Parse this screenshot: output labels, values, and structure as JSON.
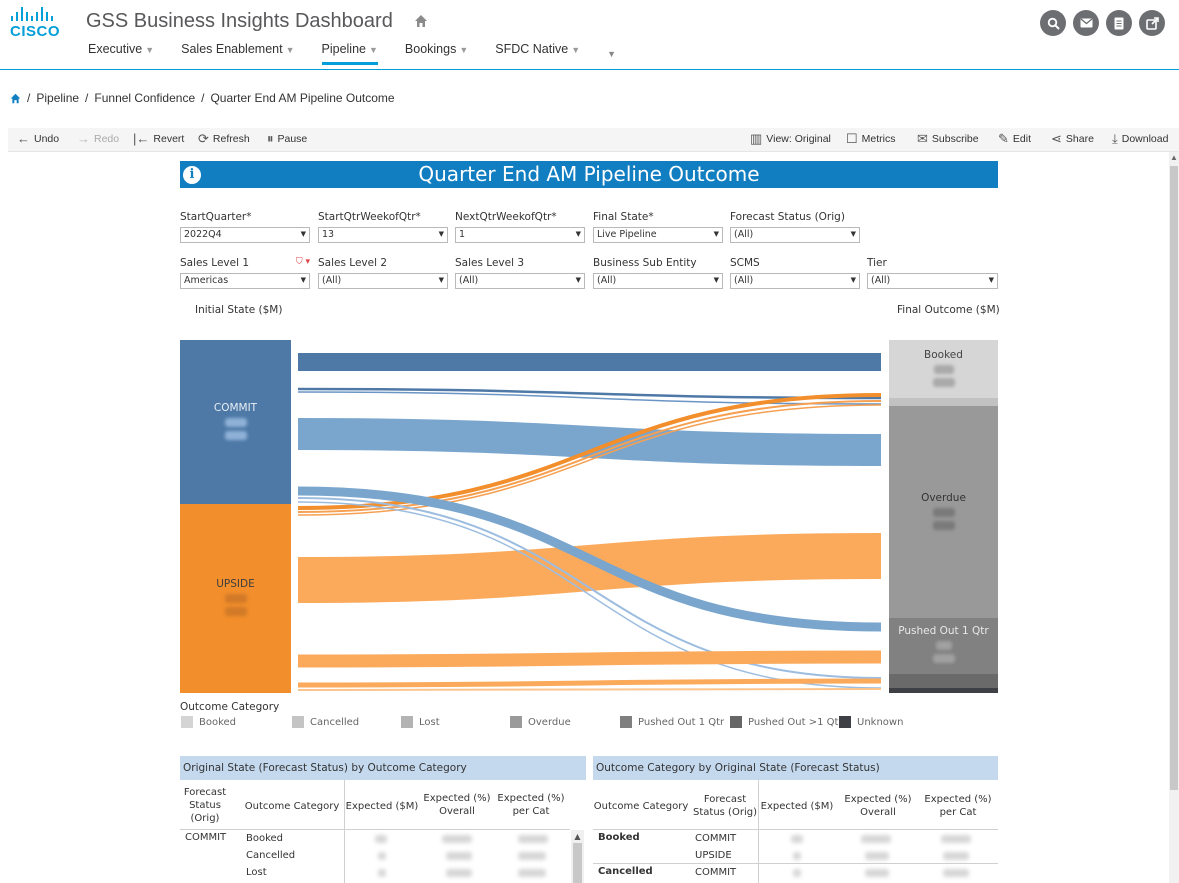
{
  "header": {
    "logo_text": "CISCO",
    "app_title": "GSS Business Insights Dashboard",
    "home_icon": "home-icon",
    "action_icons": [
      "search-icon",
      "mail-icon",
      "document-icon",
      "external-link-icon"
    ]
  },
  "nav": {
    "items": [
      {
        "label": "Executive",
        "active": false
      },
      {
        "label": "Sales Enablement",
        "active": false
      },
      {
        "label": "Pipeline",
        "active": true
      },
      {
        "label": "Bookings",
        "active": false
      },
      {
        "label": "SFDC Native",
        "active": false
      }
    ]
  },
  "breadcrumb": [
    "Pipeline",
    "Funnel Confidence",
    "Quarter End AM Pipeline Outcome"
  ],
  "toolbar": {
    "undo": "Undo",
    "redo": "Redo",
    "revert": "Revert",
    "refresh": "Refresh",
    "pause": "Pause",
    "view": "View: Original",
    "metrics": "Metrics",
    "subscribe": "Subscribe",
    "edit": "Edit",
    "share": "Share",
    "download": "Download"
  },
  "dashboard": {
    "title": "Quarter End AM Pipeline Outcome",
    "info_icon": "i",
    "filters_row1": [
      {
        "label": "StartQuarter*",
        "value": "2022Q4"
      },
      {
        "label": "StartQtrWeekofQtr*",
        "value": "13"
      },
      {
        "label": "NextQtrWeekofQtr*",
        "value": "1"
      },
      {
        "label": "Final State*",
        "value": "Live Pipeline"
      },
      {
        "label": "Forecast Status (Orig)",
        "value": "(All)"
      }
    ],
    "filters_row2": [
      {
        "label": "Sales Level 1",
        "value": "Americas"
      },
      {
        "label": "Sales Level 2",
        "value": "(All)"
      },
      {
        "label": "Sales Level 3",
        "value": "(All)"
      },
      {
        "label": "Business Sub Entity",
        "value": "(All)"
      },
      {
        "label": "SCMS",
        "value": "(All)"
      },
      {
        "label": "Tier",
        "value": "(All)"
      }
    ]
  },
  "chart_data": {
    "type": "sankey",
    "left_title": "Initial State ($M)",
    "right_title": "Final Outcome ($M)",
    "left_nodes": [
      {
        "name": "COMMIT",
        "color": "#4e79a7"
      },
      {
        "name": "UPSIDE",
        "color": "#f28e2b"
      }
    ],
    "right_nodes": [
      {
        "name": "Booked",
        "color": "#d4d4d4"
      },
      {
        "name": "Overdue",
        "color": "#999999"
      },
      {
        "name": "Pushed Out 1 Qtr",
        "color": "#818181"
      }
    ],
    "colors": {
      "commit": "#4e79a7",
      "commit_light": "#7aa6ce",
      "upside": "#f28e2b",
      "upside_light": "#fbaa5c"
    }
  },
  "legend": {
    "title": "Outcome Category",
    "items": [
      {
        "label": "Booked",
        "color": "#d4d4d4"
      },
      {
        "label": "Cancelled",
        "color": "#c4c4c4"
      },
      {
        "label": "Lost",
        "color": "#b3b3b3"
      },
      {
        "label": "Overdue",
        "color": "#9a9a9a"
      },
      {
        "label": "Pushed Out 1 Qtr",
        "color": "#7f7f7f"
      },
      {
        "label": "Pushed Out >1 Qtr",
        "color": "#666666"
      },
      {
        "label": "Unknown",
        "color": "#3f3f46"
      }
    ]
  },
  "table_left": {
    "title": "Original State (Forecast Status) by Outcome Category",
    "columns": [
      "Forecast Status (Orig)",
      "Outcome Category",
      "Expected ($M)",
      "Expected (%) Overall",
      "Expected (%) per Cat"
    ],
    "rows": [
      {
        "status": "COMMIT",
        "category": "Booked"
      },
      {
        "status": "",
        "category": "Cancelled"
      },
      {
        "status": "",
        "category": "Lost"
      }
    ]
  },
  "table_right": {
    "title": "Outcome Category by Original State (Forecast Status)",
    "columns": [
      "Outcome Category",
      "Forecast Status (Orig)",
      "Expected ($M)",
      "Expected (%) Overall",
      "Expected (%) per Cat"
    ],
    "rows": [
      {
        "category": "Booked",
        "status": "COMMIT"
      },
      {
        "category": "",
        "status": "UPSIDE"
      },
      {
        "category": "Cancelled",
        "status": "COMMIT"
      }
    ]
  }
}
